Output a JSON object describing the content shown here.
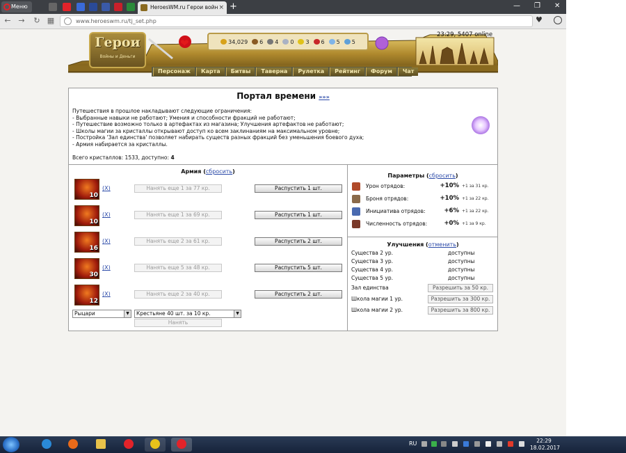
{
  "browser": {
    "menu_label": "Меню",
    "tab_title": "HeroesWM.ru Герои войн",
    "url": "www.heroeswm.ru/tj_set.php",
    "tab_close": "×",
    "new_tab": "+"
  },
  "game_header": {
    "logo_text": "Герои",
    "logo_subtitle": "Войны и Деньги",
    "time_online": "23:29, 5407 online",
    "resources": [
      {
        "name": "gold",
        "value": "34,029",
        "color": "#d8a21a"
      },
      {
        "name": "wood",
        "value": "6",
        "color": "#8a5a22"
      },
      {
        "name": "ore",
        "value": "4",
        "color": "#777777"
      },
      {
        "name": "mercury",
        "value": "0",
        "color": "#aab2c4"
      },
      {
        "name": "sulfur",
        "value": "3",
        "color": "#e0c21a"
      },
      {
        "name": "crystals",
        "value": "6",
        "color": "#c8282a"
      },
      {
        "name": "gems",
        "value": "5",
        "color": "#7fb4e8"
      },
      {
        "name": "diamonds",
        "value": "5",
        "color": "#5fa0d8"
      }
    ],
    "nav": [
      "Персонаж",
      "Карта",
      "Битвы",
      "Таверна",
      "Рулетка",
      "Рейтинг",
      "Форум",
      "Чат"
    ]
  },
  "portal": {
    "title": "Портал времени",
    "title_link": "»»»",
    "restrictions": [
      "Путешествия в прошлое накладывают следующие ограничения:",
      "- Выбранные навыки не работают; Умения и способности фракций не работают;",
      "- Путешествие возможно только в артефактах из магазина; Улучшения артефактов не работают;",
      "- Школы магии за кристаллы открывают доступ ко всем заклинаниям на максимальном уровне;",
      "- Постройка 'Зал единства' позволяет набирать существ разных фракций без уменьшения боевого духа;",
      "- Армия набирается за кристаллы."
    ],
    "crystals_text": "Всего кристаллов: 1533, доступно: ",
    "crystals_available": "4"
  },
  "army": {
    "title": "Армия",
    "reset_link": "сбросить",
    "x_label": "X",
    "units": [
      {
        "count": "10",
        "hire": "Нанять еще 1 за 77 кр.",
        "dismiss": "Распустить 1 шт."
      },
      {
        "count": "10",
        "hire": "Нанять еще 1 за 69 кр.",
        "dismiss": "Распустить 1 шт."
      },
      {
        "count": "16",
        "hire": "Нанять еще 2 за 61 кр.",
        "dismiss": "Распустить 2 шт."
      },
      {
        "count": "30",
        "hire": "Нанять еще 5 за 48 кр.",
        "dismiss": "Распустить 5 шт."
      },
      {
        "count": "12",
        "hire": "Нанять еще 2 за 40 кр.",
        "dismiss": "Распустить 2 шт."
      }
    ],
    "faction_select": "Рыцари",
    "creature_select": "Крестьяне 40 шт. за 10 кр.",
    "hire_button": "Нанять"
  },
  "parameters": {
    "title": "Параметры",
    "reset_link": "сбросить",
    "items": [
      {
        "label": "Урон отрядов:",
        "value": "+10%",
        "cost": "+1 за 31 кр.",
        "color": "#b04a2a"
      },
      {
        "label": "Броня отрядов:",
        "value": "+10%",
        "cost": "+1 за 22 кр.",
        "color": "#8a6a4a"
      },
      {
        "label": "Инициатива отрядов:",
        "value": "+6%",
        "cost": "+1 за 22 кр.",
        "color": "#4a6ab0"
      },
      {
        "label": "Численность отрядов:",
        "value": "+0%",
        "cost": "+1 за 9 кр.",
        "color": "#7a3a2a"
      }
    ]
  },
  "upgrades": {
    "title": "Улучшения",
    "cancel_link": "отменить",
    "creatures": [
      {
        "label": "Существа 2 ур.",
        "status": "доступны"
      },
      {
        "label": "Существа 3 ур.",
        "status": "доступны"
      },
      {
        "label": "Существа 4 ур.",
        "status": "доступны"
      },
      {
        "label": "Существа 5 ур.",
        "status": "доступны"
      }
    ],
    "buildings": [
      {
        "label": "Зал единства",
        "button": "Разрешить за 50 кр."
      },
      {
        "label": "Школа магии 1 ур.",
        "button": "Разрешить за 300 кр."
      },
      {
        "label": "Школа магии 2 ур.",
        "button": "Разрешить за 800 кр."
      }
    ]
  },
  "taskbar": {
    "lang": "RU",
    "time": "22:29",
    "date": "18.02.2017"
  }
}
